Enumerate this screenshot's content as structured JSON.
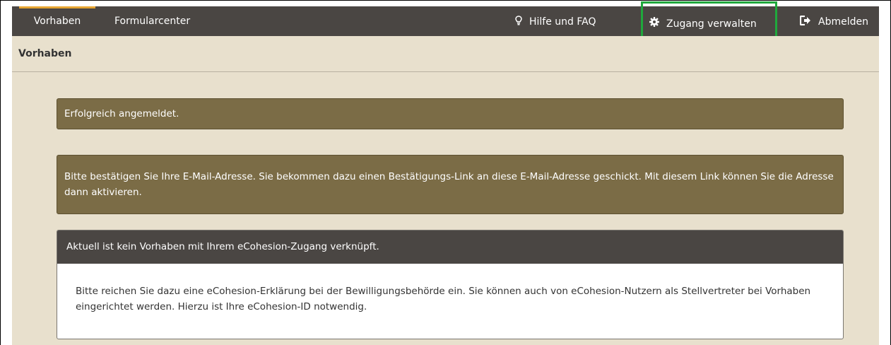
{
  "nav": {
    "vorhaben": "Vorhaben",
    "formularcenter": "Formularcenter",
    "hilfe": "Hilfe und FAQ",
    "zugang": "Zugang verwalten",
    "abmelden": "Abmelden",
    "icons": {
      "hilfe": "lightbulb-icon",
      "zugang": "gear-icon",
      "abmelden": "logout-icon"
    }
  },
  "breadcrumb": "Vorhaben",
  "alerts": {
    "login": "Erfolgreich angemeldet.",
    "email": "Bitte bestätigen Sie Ihre E-Mail-Adresse. Sie bekommen dazu einen Bestätigungs-Link an diese E-Mail-Adresse geschickt. Mit diesem Link können Sie die Adresse dann aktivieren."
  },
  "panel": {
    "title": "Aktuell ist kein Vorhaben mit Ihrem eCohesion-Zugang verknüpft.",
    "body": "Bitte reichen Sie dazu eine eCohesion-Erklärung bei der Bewilligungsbehörde ein. Sie können auch von eCohesion-Nutzern als Stellvertreter bei Vorhaben eingerichtet werden. Hierzu ist Ihre eCohesion-ID notwendig."
  },
  "colors": {
    "nav_bg": "#4a4643",
    "active_accent": "#e6a532",
    "alert_bg": "#7b6c46",
    "content_bg": "#e8e0cd",
    "highlight": "#1fa83c"
  }
}
